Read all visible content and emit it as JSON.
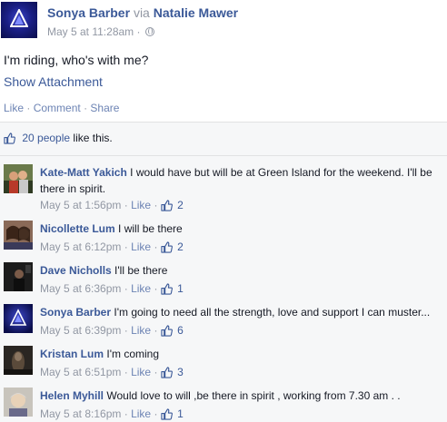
{
  "post": {
    "author": "Sonya Barber",
    "via_label": "via",
    "via_name": "Natalie Mawer",
    "timestamp": "May 5 at 11:28am",
    "separator": "·",
    "text": "I'm riding, who's with me?",
    "attachment_link": "Show Attachment",
    "actions": {
      "like": "Like",
      "comment": "Comment",
      "share": "Share"
    }
  },
  "likes": {
    "count_text": "20 people",
    "suffix": "like this."
  },
  "comments": [
    {
      "author": "Kate-Matt Yakich",
      "text": "I would have but will be at Green Island for the weekend. I'll be there in spirit.",
      "time": "May 5 at 1:56pm",
      "like_label": "Like",
      "likes": "2",
      "avatar": "couple-photo"
    },
    {
      "author": "Nicollette Lum",
      "text": "I will be there",
      "time": "May 5 at 6:12pm",
      "like_label": "Like",
      "likes": "2",
      "avatar": "selfie-photo"
    },
    {
      "author": "Dave Nicholls",
      "text": "I'll be there",
      "time": "May 5 at 6:36pm",
      "like_label": "Like",
      "likes": "1",
      "avatar": "dark-photo"
    },
    {
      "author": "Sonya Barber",
      "text": "I'm going to need all the strength, love and support I can muster...",
      "time": "May 5 at 6:39pm",
      "like_label": "Like",
      "likes": "6",
      "avatar": "blue-logo"
    },
    {
      "author": "Kristan Lum",
      "text": "I'm coming",
      "time": "May 5 at 6:51pm",
      "like_label": "Like",
      "likes": "3",
      "avatar": "dark-figure-photo"
    },
    {
      "author": "Helen Myhill",
      "text": "Would love to will ,be there in spirit , working from 7.30 am . .",
      "time": "May 5 at 8:16pm",
      "like_label": "Like",
      "likes": "1",
      "avatar": "portrait-photo"
    }
  ],
  "colors": {
    "link": "#3b5998",
    "meta": "#9197a3",
    "feedback_bg": "#f6f7f8"
  }
}
